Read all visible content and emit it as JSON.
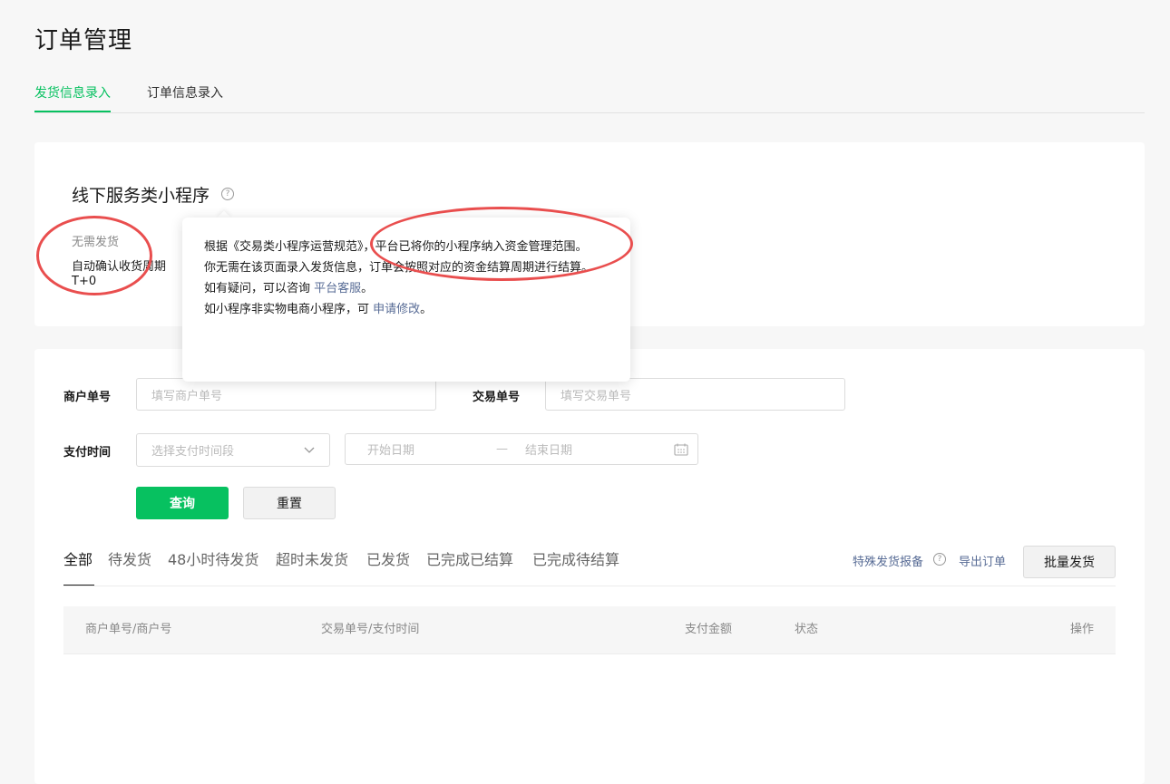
{
  "page": {
    "title": "订单管理",
    "tabs": [
      {
        "label": "发货信息录入",
        "active": true
      },
      {
        "label": "订单信息录入",
        "active": false
      }
    ]
  },
  "service_card": {
    "title": "线下服务类小程序",
    "help_icon": "question-circle-icon",
    "no_shipping": "无需发货",
    "auto_confirm_label": "自动确认收货周期",
    "auto_confirm_value": "T+0"
  },
  "popover": {
    "line1": "根据《交易类小程序运营规范》，平台已将你的小程序纳入资金管理范围。",
    "line2": "你无需在该页面录入发货信息，订单会按照对应的资金结算周期进行结算。",
    "line3_prefix": "如有疑问，可以咨询 ",
    "line3_link": "平台客服",
    "line3_suffix": "。",
    "line4_prefix": "如小程序非实物电商小程序，可 ",
    "line4_link": "申请修改",
    "line4_suffix": "。"
  },
  "filters": {
    "merchant_no_label": "商户单号",
    "merchant_no_placeholder": "填写商户单号",
    "trade_no_label": "交易单号",
    "trade_no_placeholder": "填写交易单号",
    "pay_time_label": "支付时间",
    "pay_time_select_placeholder": "选择支付时间段",
    "start_date_placeholder": "开始日期",
    "date_separator": "—",
    "end_date_placeholder": "结束日期",
    "query_button": "查询",
    "reset_button": "重置"
  },
  "order_tabs": [
    {
      "label": "全部",
      "active": true
    },
    {
      "label": "待发货",
      "active": false
    },
    {
      "label": "48小时待发货",
      "active": false
    },
    {
      "label": "超时未发货",
      "active": false
    },
    {
      "label": "已发货",
      "active": false
    },
    {
      "label": "已完成已结算",
      "active": false
    },
    {
      "label": "已完成待结算",
      "active": false
    }
  ],
  "actions": {
    "special_report": "特殊发货报备",
    "export_orders": "导出订单",
    "batch_ship": "批量发货"
  },
  "table": {
    "headers": [
      "商户单号/商户号",
      "交易单号/支付时间",
      "支付金额",
      "状态",
      "操作"
    ]
  },
  "colors": {
    "accent": "#07c160",
    "link": "#576b95",
    "annotation": "#e94e4e"
  }
}
